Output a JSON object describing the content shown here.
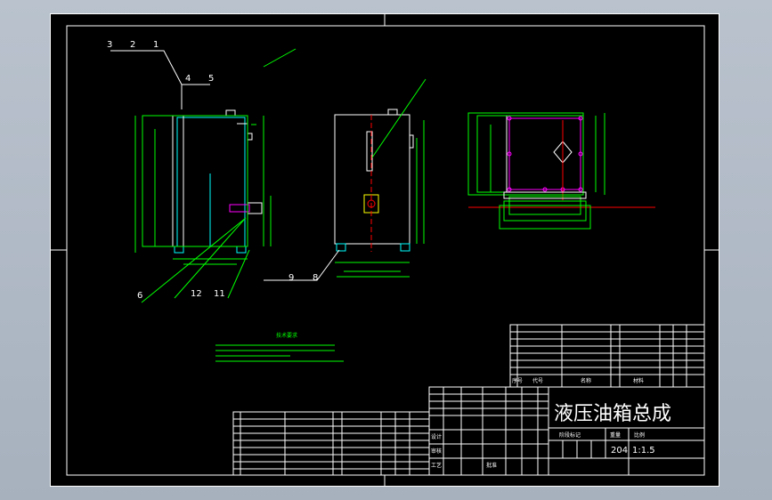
{
  "title_block": {
    "drawing_title": "液压油箱总成",
    "scale": "1:1.5",
    "quantity": "204",
    "header_sequence": "序号",
    "header_code": "代号",
    "header_name": "名称",
    "header_material": "材料",
    "designer_label": "设计",
    "review_label": "审核",
    "process_label": "工艺",
    "approve_label": "批准",
    "stage_label": "阶段标记",
    "weight_label": "重量",
    "scale_label": "比例"
  },
  "balloons": [
    "3",
    "2",
    "1",
    "4",
    "5",
    "6",
    "12",
    "11",
    "9",
    "8"
  ],
  "tech_requirements": {
    "heading": "技术要求"
  }
}
